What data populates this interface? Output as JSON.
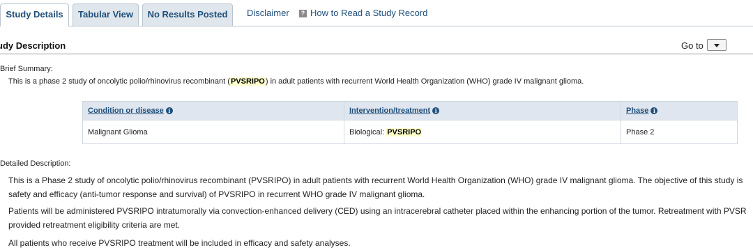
{
  "tabs": {
    "study_details": "Study Details",
    "tabular_view": "Tabular View",
    "no_results": "No Results Posted",
    "disclaimer": "Disclaimer",
    "how_to_read": "How to Read a Study Record"
  },
  "section": {
    "title": "udy Description",
    "goto_label": "Go to"
  },
  "brief": {
    "label": "Brief Summary:",
    "text_before": "This is a phase 2 study of oncolytic polio/rhinovirus recombinant (",
    "highlight": "PVSRIPO",
    "text_after": ") in adult patients with recurrent World Health Organization (WHO) grade IV malignant glioma."
  },
  "table": {
    "headers": [
      "Condition or disease",
      "Intervention/treatment",
      "Phase"
    ],
    "condition": "Malignant Glioma",
    "intervention_prefix": "Biological: ",
    "intervention_highlight": "PVSRIPO",
    "phase": "Phase 2"
  },
  "detailed": {
    "label": "Detailed Description:",
    "p1_line1": "This is a Phase 2 study of oncolytic polio/rhinovirus recombinant (PVSRIPO) in adult patients with recurrent World Health Organization (WHO) grade IV malignant glioma. The objective of this study is",
    "p1_line2": "safety and efficacy (anti-tumor response and survival) of PVSRIPO in recurrent WHO grade IV malignant glioma.",
    "p2_line1": "Patients will be administered PVSRIPO intratumorally via convection-enhanced delivery (CED) using an intracerebral catheter placed within the enhancing portion of the tumor. Retreatment with PVSR",
    "p2_line2": "provided retreatment eligibility criteria are met.",
    "p3": "All patients who receive PVSRIPO treatment will be included in efficacy and safety analyses."
  },
  "icons": {
    "help": "question-icon",
    "info": "info-icon",
    "dropdown": "caret-down-icon"
  },
  "colors": {
    "tab_text": "#1f4f7a",
    "highlight": "#ffffcc",
    "header_bg": "#dfe6ef"
  }
}
